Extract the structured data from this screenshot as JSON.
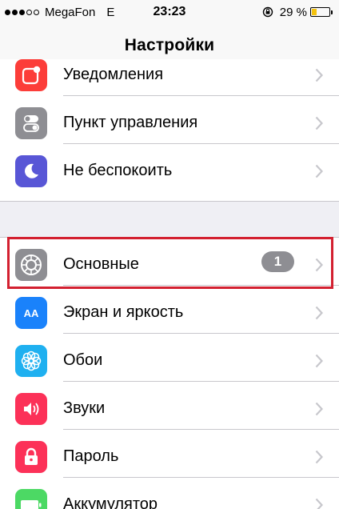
{
  "status_bar": {
    "carrier": "MegaFon",
    "network": "E",
    "time": "23:23",
    "battery_percent": "29 %",
    "battery_level": 0.29,
    "battery_color": "#f4c20d",
    "signal_bars_filled": 3,
    "signal_bars_total": 5
  },
  "nav": {
    "title": "Настройки"
  },
  "groups": [
    {
      "items": [
        {
          "label": "Уведомления",
          "icon": "notifications-icon",
          "color": "#fc3d39"
        },
        {
          "label": "Пункт управления",
          "icon": "control-center-icon",
          "color": "#8e8e93"
        },
        {
          "label": "Не беспокоить",
          "icon": "moon-icon",
          "color": "#5856d6"
        }
      ]
    },
    {
      "items": [
        {
          "label": "Основные",
          "icon": "gear-icon",
          "color": "#8e8e93",
          "badge": "1",
          "highlighted": true
        },
        {
          "label": "Экран и яркость",
          "icon": "display-brightness-icon",
          "color": "#1a82fb",
          "icon_text": "AA"
        },
        {
          "label": "Обои",
          "icon": "wallpaper-icon",
          "color": "#1fb0f0"
        },
        {
          "label": "Звуки",
          "icon": "speaker-icon",
          "color": "#fc3158"
        },
        {
          "label": "Пароль",
          "icon": "lock-icon",
          "color": "#fc3158"
        },
        {
          "label": "Аккумулятор",
          "icon": "battery-icon",
          "color": "#4cd964"
        }
      ]
    }
  ]
}
